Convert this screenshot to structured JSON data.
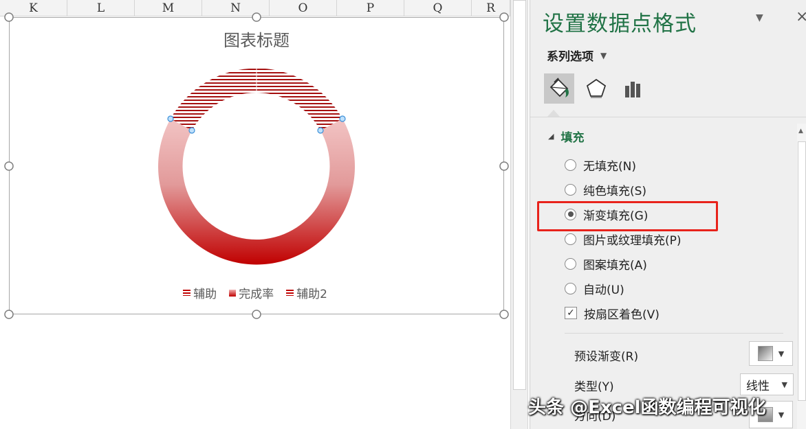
{
  "sheet": {
    "columns": [
      "K",
      "L",
      "M",
      "N",
      "O",
      "P",
      "Q",
      "R"
    ]
  },
  "chart": {
    "title": "图表标题",
    "legend": [
      {
        "label": "辅助",
        "key": "lines"
      },
      {
        "label": "完成率",
        "key": "gradient"
      },
      {
        "label": "辅助2",
        "key": "lines"
      }
    ],
    "colors": {
      "ring_light": "#eab8b8",
      "ring_dark": "#c00000",
      "stripe": "#a50f0f",
      "handle_fill": "#bfe0fb",
      "handle_stroke": "#3a8fd8"
    }
  },
  "chart_data": {
    "type": "doughnut",
    "title": "图表标题",
    "series_shown": [
      "辅助",
      "完成率",
      "辅助2"
    ],
    "note_visible": "top arc striped (辅助), main ring gradient filled (完成率)"
  },
  "pane": {
    "title": "设置数据点格式",
    "series_options_label": "系列选项",
    "tabs": [
      {
        "icon": "fill-bucket-icon",
        "active": true
      },
      {
        "icon": "pentagon-effects-icon",
        "active": false
      },
      {
        "icon": "bar-chart-icon",
        "active": false
      }
    ],
    "section_title": "填充",
    "fill_options": [
      {
        "label": "无填充(N)",
        "checked": false
      },
      {
        "label": "纯色填充(S)",
        "checked": false
      },
      {
        "label": "渐变填充(G)",
        "checked": true
      },
      {
        "label": "图片或纹理填充(P)",
        "checked": false
      },
      {
        "label": "图案填充(A)",
        "checked": false
      },
      {
        "label": "自动(U)",
        "checked": false
      }
    ],
    "vary_colors_label": "按扇区着色(V)",
    "vary_colors_checked": true,
    "preset_gradient_label": "预设渐变(R)",
    "type_label": "类型(Y)",
    "type_value": "线性",
    "direction_label": "方向(D)"
  },
  "watermark": "头条 @Excel函数编程可视化",
  "accent_color": "#217346",
  "highlight_color": "#e8221b"
}
